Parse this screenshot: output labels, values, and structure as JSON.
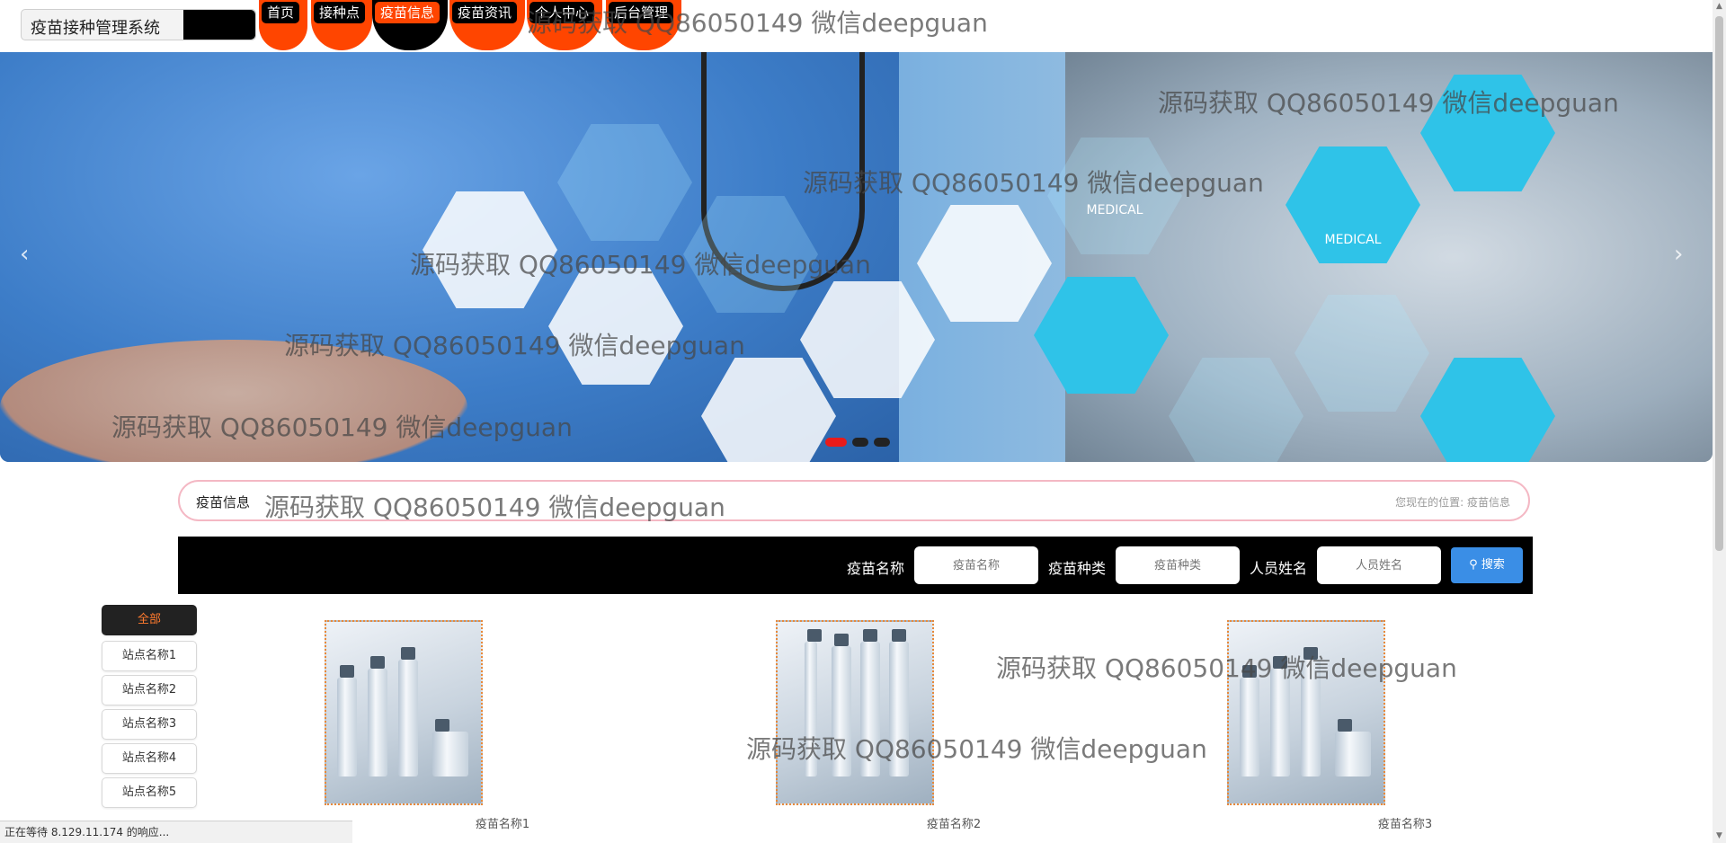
{
  "header": {
    "site_title": "疫苗接种管理系统",
    "nav": [
      {
        "label": "首页"
      },
      {
        "label": "接种点"
      },
      {
        "label": "疫苗信息",
        "active": true
      },
      {
        "label": "疫苗资讯"
      },
      {
        "label": "个人中心"
      },
      {
        "label": "后台管理"
      }
    ]
  },
  "watermark": "源码获取 QQ86050149 微信deepguan",
  "banner": {
    "hex_labels": [
      "MEDICAL",
      "MEDICAL"
    ],
    "prev_icon": "chevron-left-icon",
    "next_icon": "chevron-right-icon",
    "slide_count": 3,
    "active_slide": 1
  },
  "section": {
    "title": "疫苗信息",
    "breadcrumb_prefix": "您现在的位置:",
    "breadcrumb_current": "疫苗信息"
  },
  "search": {
    "fields": [
      {
        "label": "疫苗名称",
        "placeholder": "疫苗名称"
      },
      {
        "label": "疫苗种类",
        "placeholder": "疫苗种类"
      },
      {
        "label": "人员姓名",
        "placeholder": "人员姓名"
      }
    ],
    "button_label": "搜索",
    "button_icon": "search-icon"
  },
  "sidebar": {
    "items": [
      "全部",
      "站点名称1",
      "站点名称2",
      "站点名称3",
      "站点名称4",
      "站点名称5"
    ],
    "active_index": 0
  },
  "products": [
    {
      "name": "疫苗名称1"
    },
    {
      "name": "疫苗名称2"
    },
    {
      "name": "疫苗名称3"
    }
  ],
  "status_bar": "正在等待 8.129.11.174 的响应...",
  "colors": {
    "accent_orange": "#ff4500",
    "search_button": "#3a8ee6",
    "header_border": "#f4b8c4",
    "active_dot": "#e81b1b"
  }
}
